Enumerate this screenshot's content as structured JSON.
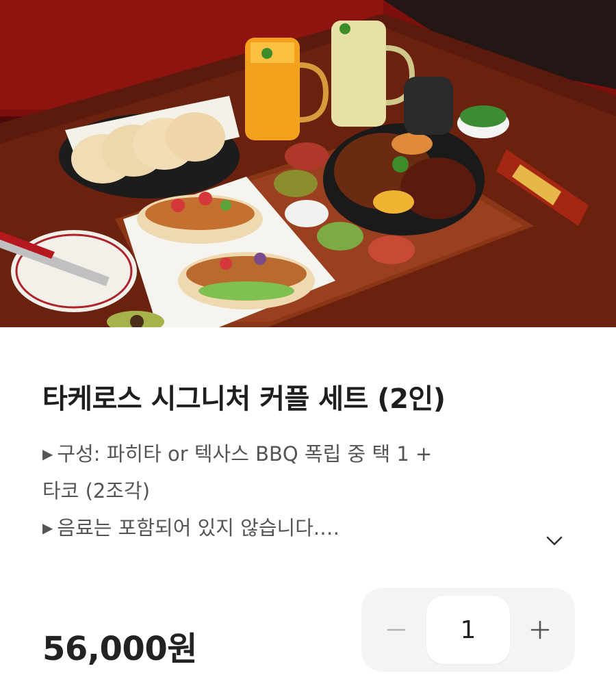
{
  "product": {
    "title": "타케로스 시그니처 커플 세트 (2인)",
    "description": [
      {
        "bullet": "▶",
        "text": "구성: 파히타 or 텍사스 BBQ 폭립 중 택 1 +"
      },
      {
        "bullet": "",
        "text": "타코 (2조각)"
      },
      {
        "bullet": "▶",
        "text": "음료는 포함되어 있지 않습니다.…"
      }
    ],
    "price": "56,000원"
  },
  "quantity": {
    "value": "1"
  },
  "icons": {
    "expand": "chevron-down-icon",
    "decrease": "minus-icon",
    "increase": "plus-icon"
  },
  "colors": {
    "stepper_bg": "#f3f4f6",
    "disabled_icon": "#b3b3b3",
    "text_primary": "#1e1e1e",
    "text_secondary": "#555555"
  }
}
